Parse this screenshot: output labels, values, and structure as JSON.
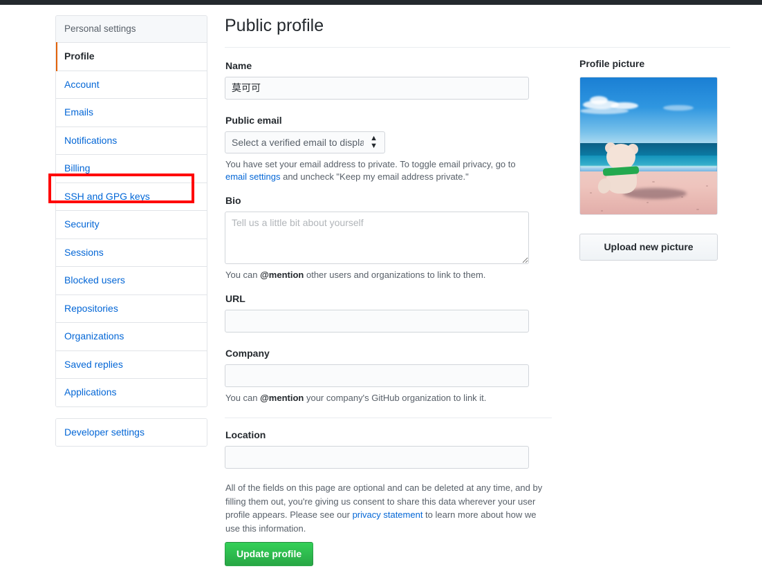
{
  "sidebar": {
    "header": "Personal settings",
    "items": [
      {
        "label": "Profile",
        "selected": true
      },
      {
        "label": "Account",
        "selected": false
      },
      {
        "label": "Emails",
        "selected": false
      },
      {
        "label": "Notifications",
        "selected": false
      },
      {
        "label": "Billing",
        "selected": false
      },
      {
        "label": "SSH and GPG keys",
        "selected": false
      },
      {
        "label": "Security",
        "selected": false
      },
      {
        "label": "Sessions",
        "selected": false
      },
      {
        "label": "Blocked users",
        "selected": false
      },
      {
        "label": "Repositories",
        "selected": false
      },
      {
        "label": "Organizations",
        "selected": false
      },
      {
        "label": "Saved replies",
        "selected": false
      },
      {
        "label": "Applications",
        "selected": false
      }
    ],
    "secondary_items": [
      {
        "label": "Developer settings"
      }
    ]
  },
  "annotation": {
    "target_label": "SSH and GPG keys",
    "color": "#ff0000"
  },
  "main": {
    "page_title": "Public profile",
    "name": {
      "label": "Name",
      "value": "莫可可",
      "placeholder": ""
    },
    "public_email": {
      "label": "Public email",
      "selected_option": "Select a verified email to display",
      "options": [
        "Select a verified email to display"
      ],
      "note_part1": "You have set your email address to private. To toggle email privacy, go to ",
      "note_link": "email settings",
      "note_part2": " and uncheck \"Keep my email address private.\""
    },
    "bio": {
      "label": "Bio",
      "value": "",
      "placeholder": "Tell us a little bit about yourself",
      "note_part1": "You can ",
      "note_bold": "@mention",
      "note_part2": " other users and organizations to link to them."
    },
    "url": {
      "label": "URL",
      "value": "",
      "placeholder": ""
    },
    "company": {
      "label": "Company",
      "value": "",
      "placeholder": "",
      "note_part1": "You can ",
      "note_bold": "@mention",
      "note_part2": " your company's GitHub organization to link it."
    },
    "location": {
      "label": "Location",
      "value": "",
      "placeholder": ""
    },
    "legal": {
      "part1": "All of the fields on this page are optional and can be deleted at any time, and by filling them out, you're giving us consent to share this data wherever your user profile appears. Please see our ",
      "link": "privacy statement",
      "part2": " to learn more about how we use this information."
    },
    "submit_label": "Update profile",
    "submit_color": "#2cbe4e"
  },
  "avatar": {
    "title": "Profile picture",
    "image_description": "teddy bear with green ribbon sitting on pink sand beach with blue ocean and sky",
    "upload_label": "Upload new picture"
  }
}
